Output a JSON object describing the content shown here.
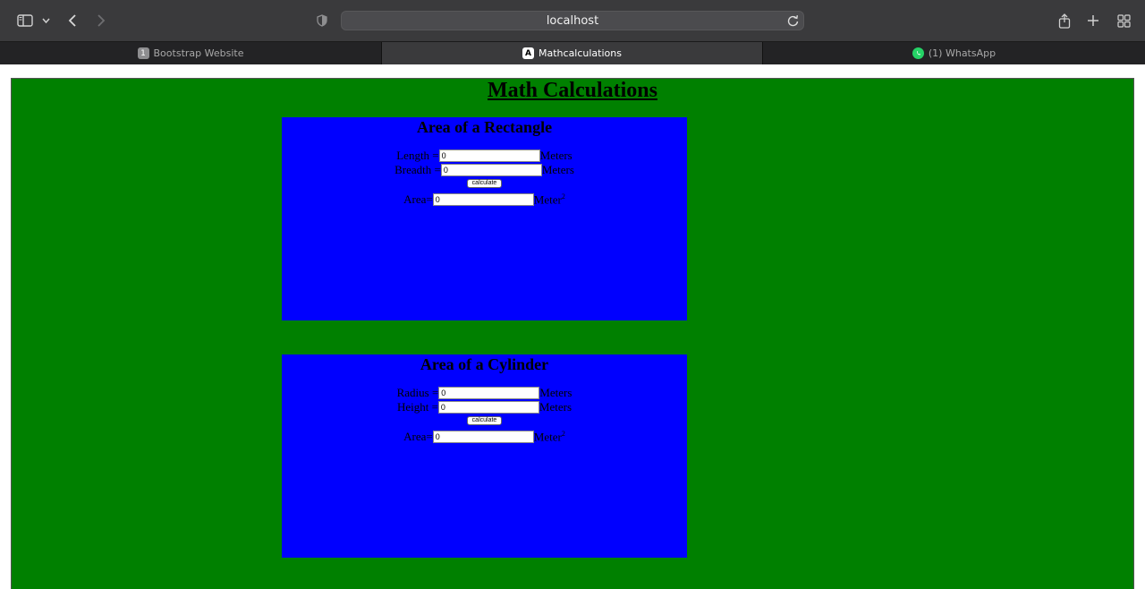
{
  "browser": {
    "url": "localhost",
    "tabs": [
      {
        "label": "Bootstrap Website",
        "badge": "1"
      },
      {
        "label": "Mathcalculations",
        "badge": "A"
      },
      {
        "label": "(1) WhatsApp"
      }
    ]
  },
  "page": {
    "title": "Math Calculations",
    "rectangle": {
      "heading": "Area of a Rectangle",
      "length_label": "Length = ",
      "length_value": "0",
      "length_unit": "Meters",
      "breadth_label": "Breadth = ",
      "breadth_value": "0",
      "breadth_unit": "Meters",
      "button": "calculate",
      "area_label": "Area=",
      "area_value": "0",
      "area_unit": "Meter",
      "area_exp": "2"
    },
    "cylinder": {
      "heading": "Area of a Cylinder",
      "radius_label": "Radius = ",
      "radius_value": "0",
      "radius_unit": "Meters",
      "height_label": "Height = ",
      "height_value": "0",
      "height_unit": "Meters",
      "button": "calculate",
      "area_label": "Area=",
      "area_value": "0",
      "area_unit": "Meter",
      "area_exp": "2"
    }
  },
  "colors": {
    "page_bg": "#008000",
    "panel_bg": "#0000ff",
    "toolbar_bg": "#3a3a3c"
  }
}
